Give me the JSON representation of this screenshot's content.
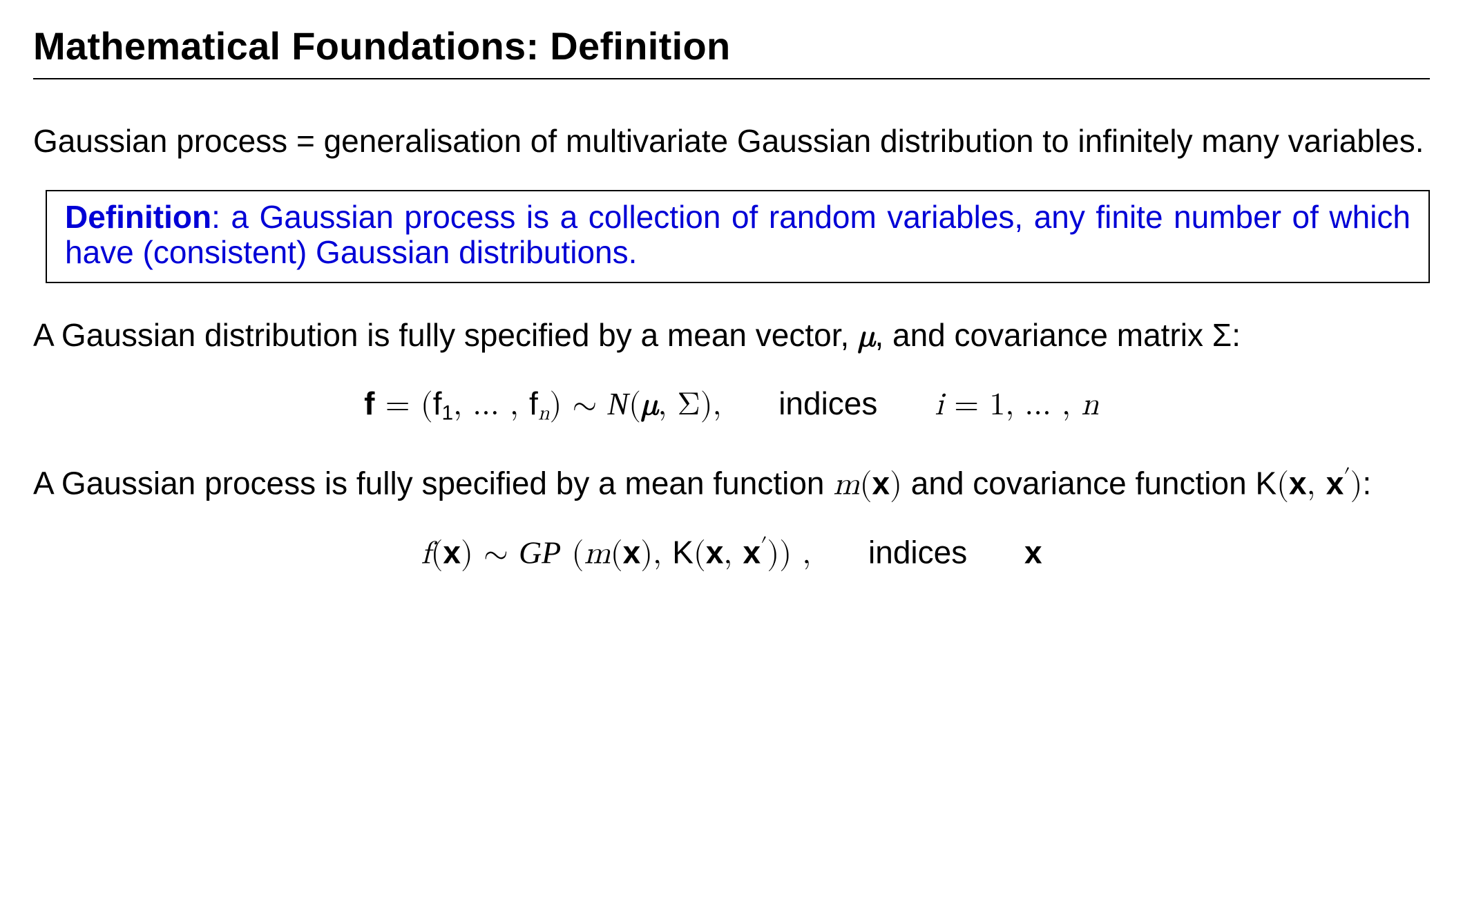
{
  "title": "Mathematical Foundations: Definition",
  "p1": "Gaussian process = generalisation of multivariate Gaussian distribution to infinitely many variables.",
  "def": {
    "label": "Definition",
    "text": ": a Gaussian process is a collection of random variables, any finite number of which have (consistent) Gaussian distributions."
  },
  "p2a": "A Gaussian distribution is fully specified by a mean vector, ",
  "p2b": ", and covariance matrix Σ:",
  "mu": "μ",
  "eq1": {
    "lhs_f": "f",
    "eq": " = (",
    "f1": "f",
    "sub1": "1",
    "dots": ", … , ",
    "fn": "f",
    "subn": "n",
    "close": ") ∼ ",
    "N": "N",
    "paren_open": "(",
    "mu": "μ",
    "comma": ", Σ),",
    "indices_label": "indices",
    "i": "i",
    "range": " = 1, … , ",
    "n": "n"
  },
  "p3a": "A Gaussian process is fully specified by a mean function ",
  "p3b": " and covariance function ",
  "mfunc": "m",
  "x": "x",
  "K": "K",
  "xprime_label": "x",
  "prime": "′",
  "p3c": ":",
  "eq2": {
    "f": "f",
    "open": "(",
    "x": "x",
    "close_sim": ") ∼ ",
    "GP": "GP",
    "space_open": " (",
    "m": "m",
    "open2": "(",
    "x2": "x",
    "mid": "), ",
    "K": "K",
    "open3": "(",
    "x3": "x",
    "comma": ", ",
    "x4": "x",
    "prime": "′",
    "close_all": ")) ,",
    "indices_label": "indices",
    "xlast": "x"
  }
}
